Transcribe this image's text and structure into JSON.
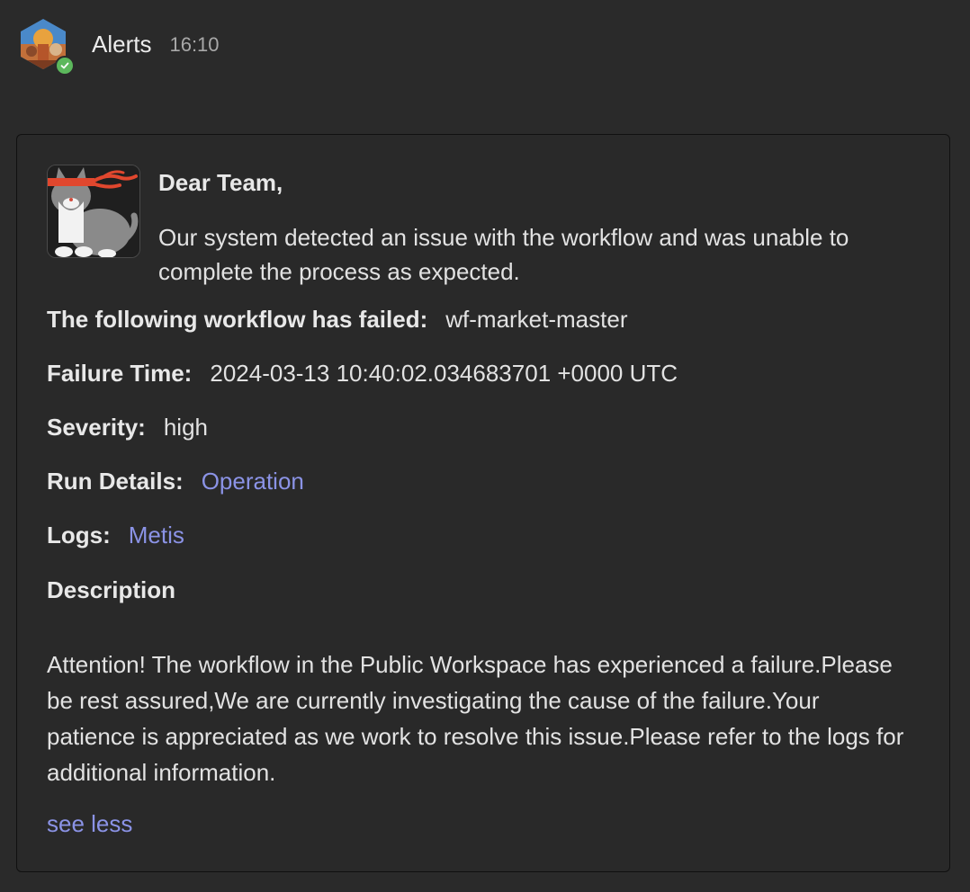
{
  "message": {
    "sender": "Alerts",
    "time": "16:10",
    "avatar_icon": "sender-avatar-image",
    "status": "available",
    "status_color": "#5cb85c"
  },
  "card": {
    "bot_icon": "ninja-cat-icon",
    "greeting": "Dear Team,",
    "intro": "Our system detected an issue with the workflow and was unable to complete the process as expected.",
    "fields": {
      "workflow_label": "The following workflow has failed:",
      "workflow_value": "wf-market-master",
      "failure_time_label": "Failure Time:",
      "failure_time_value": "2024-03-13 10:40:02.034683701 +0000 UTC",
      "severity_label": "Severity:",
      "severity_value": "high",
      "run_details_label": "Run Details:",
      "run_details_link": "Operation",
      "logs_label": "Logs:",
      "logs_link": "Metis"
    },
    "description_heading": "Description",
    "description_body": "Attention! The workflow in the Public Workspace has experienced a failure.Please be rest assured,We are currently investigating the cause of the failure.Your patience is appreciated as we work to resolve this issue.Please refer to the logs for additional information.",
    "see_less": "see less",
    "link_color": "#8b93e6"
  }
}
